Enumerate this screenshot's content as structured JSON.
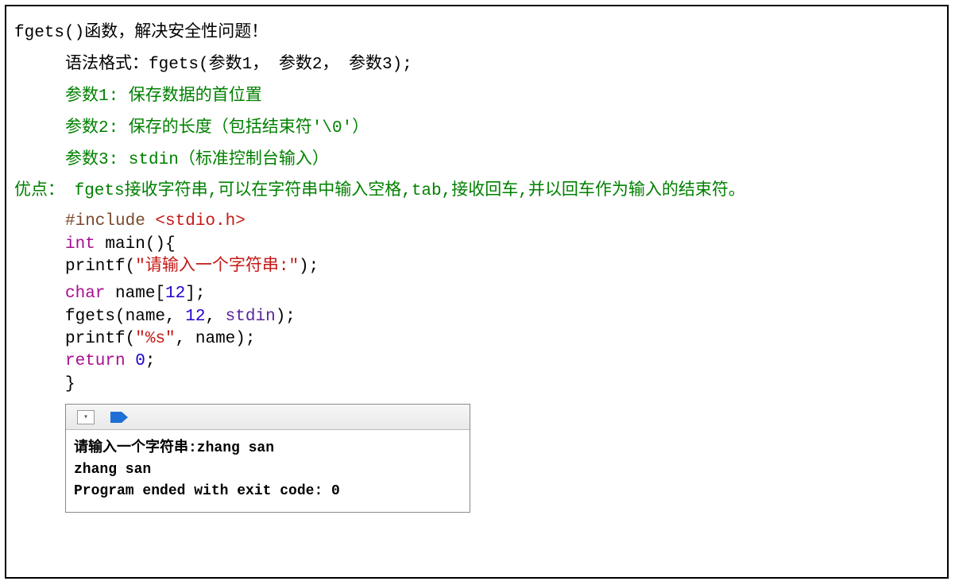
{
  "title": "fgets()函数，解决安全性问题！",
  "syntax": "语法格式：fgets(参数1， 参数2， 参数3);",
  "params": {
    "p1": "参数1: 保存数据的首位置",
    "p2": "参数2: 保存的长度（包括结束符'\\0'）",
    "p3": "参数3: stdin（标准控制台输入）"
  },
  "advantage": "优点： fgets接收字符串,可以在字符串中输入空格,tab,接收回车,并以回车作为输入的结束符。",
  "code": {
    "include_directive": "#include ",
    "include_header": "<stdio.h>",
    "l2_kw": "int",
    "l2_rest": " main(){",
    "l3_fn": "printf",
    "l3_paren_open": "(",
    "l3_str": "\"请输入一个字符串:\"",
    "l3_paren_close": ");",
    "l4_kw": "char",
    "l4_name": " name[",
    "l4_num": "12",
    "l4_close": "];",
    "l5_fn": "fgets(name, ",
    "l5_num": "12",
    "l5_mid": ", ",
    "l5_stdin": "stdin",
    "l5_end": ");",
    "l6_fn": "printf",
    "l6_open": "(",
    "l6_str": "\"%s\"",
    "l6_rest": ", name);",
    "l7_kw": "return",
    "l7_sp": " ",
    "l7_num": "0",
    "l7_end": ";",
    "l8": "}"
  },
  "console": {
    "line1": "请输入一个字符串:zhang san",
    "line2": "zhang san",
    "line3": "Program ended with exit code: 0"
  }
}
